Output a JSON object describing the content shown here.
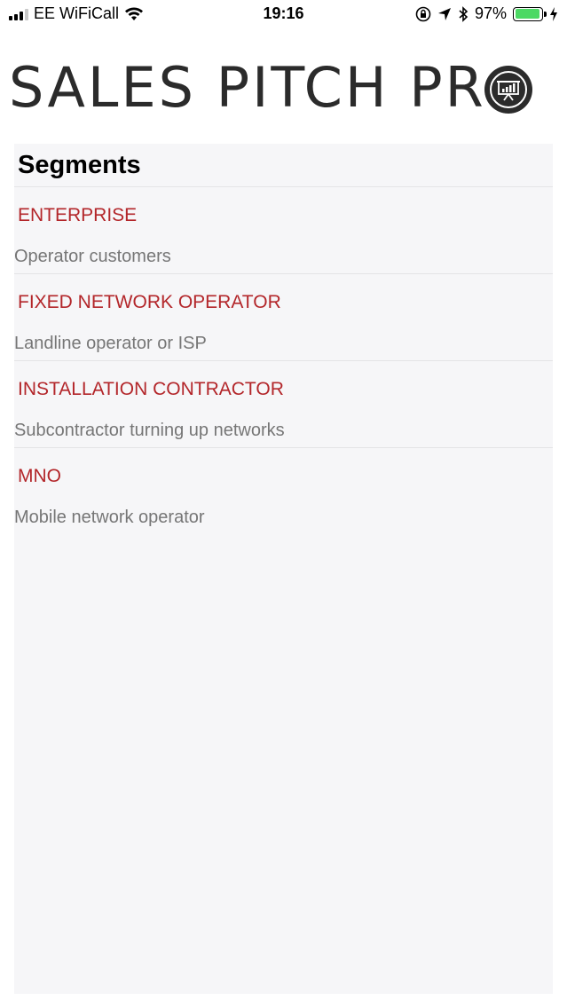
{
  "status_bar": {
    "carrier": "EE WiFiCall",
    "time": "19:16",
    "battery_percent": "97%",
    "icons": [
      "signal-icon",
      "wifi-icon",
      "orientation-lock-icon",
      "location-icon",
      "bluetooth-icon",
      "battery-icon",
      "charging-icon"
    ]
  },
  "app": {
    "logo_text": "SALES PITCH PR",
    "logo_icon": "presentation-board-icon"
  },
  "segments_panel": {
    "title": "Segments",
    "items": [
      {
        "title": "ENTERPRISE",
        "description": "Operator customers"
      },
      {
        "title": "FIXED NETWORK OPERATOR",
        "description": "Landline operator or ISP"
      },
      {
        "title": "INSTALLATION CONTRACTOR",
        "description": "Subcontractor turning up networks"
      },
      {
        "title": "MNO",
        "description": "Mobile network operator"
      }
    ]
  },
  "colors": {
    "accent": "#b3262a",
    "description": "#767676",
    "panel_bg": "#f6f6f8",
    "battery": "#4cd964"
  }
}
